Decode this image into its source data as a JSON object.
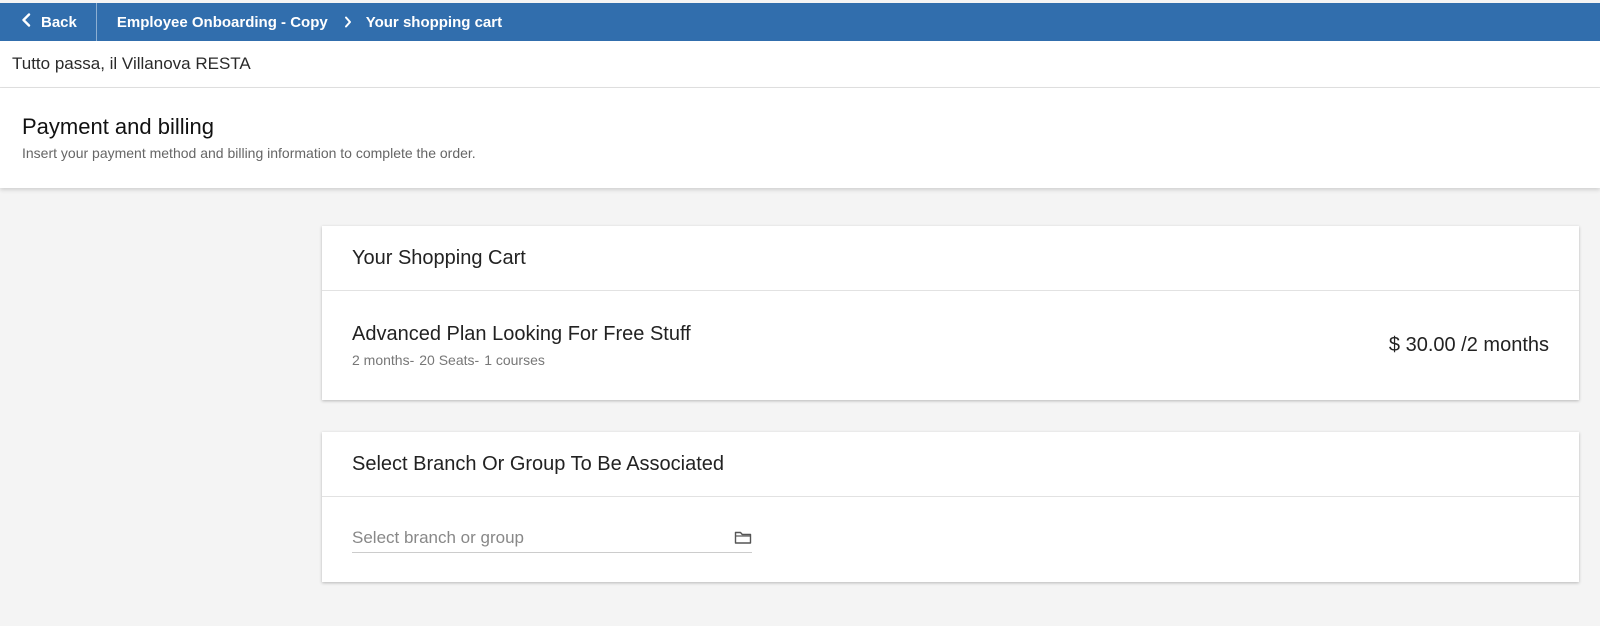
{
  "topbar": {
    "back_label": "Back",
    "breadcrumb": [
      "Employee Onboarding - Copy",
      "Your shopping cart"
    ],
    "background": "#316ead"
  },
  "subheader": {
    "text": "Tutto passa, il Villanova RESTA"
  },
  "page": {
    "title": "Payment and billing",
    "subtitle": "Insert your payment method and billing information to complete the order."
  },
  "cart": {
    "title": "Your Shopping Cart",
    "item": {
      "name": "Advanced Plan Looking For Free Stuff",
      "meta": [
        "2 months-",
        "20 Seats-",
        "1 courses"
      ],
      "price": "$ 30.00 /2 months"
    }
  },
  "branch": {
    "title": "Select Branch Or Group To Be Associated",
    "placeholder": "Select branch or group",
    "icon": "folder-icon"
  }
}
